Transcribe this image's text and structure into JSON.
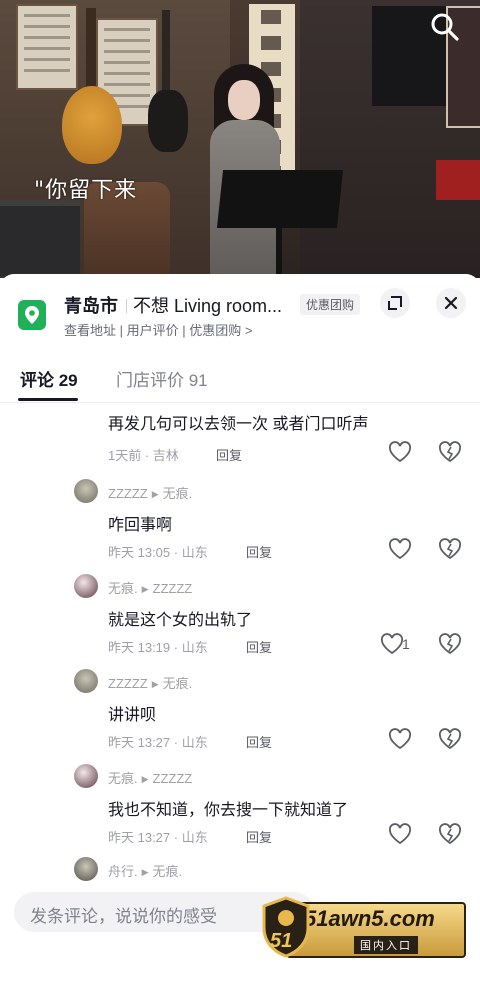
{
  "video": {
    "caption": "\"你留下来"
  },
  "store": {
    "city": "青岛市",
    "venue": "不想 Living room...",
    "deal_badge": "优惠团购",
    "subtitle": "查看地址 | 用户评价 | 优惠团购 >"
  },
  "tabs": [
    {
      "label": "评论 29",
      "active": true
    },
    {
      "label": "门店评价 91",
      "active": false
    }
  ],
  "comments": [
    {
      "user": "",
      "reply_to": "",
      "text": "再发几句可以去领一次 或者门口听声",
      "time": "1天前 · 吉林",
      "reply_label": "回复",
      "likes": ""
    },
    {
      "user": "ZZZZZ",
      "reply_to": "无痕.",
      "text": "咋回事啊",
      "time": "昨天 13:05 · 山东",
      "reply_label": "回复",
      "likes": ""
    },
    {
      "user": "无痕.",
      "reply_to": "ZZZZZ",
      "text": "就是这个女的出轨了",
      "time": "昨天 13:19 · 山东",
      "reply_label": "回复",
      "likes": "1"
    },
    {
      "user": "ZZZZZ",
      "reply_to": "无痕.",
      "text": "讲讲呗",
      "time": "昨天 13:27 · 山东",
      "reply_label": "回复",
      "likes": ""
    },
    {
      "user": "无痕.",
      "reply_to": "ZZZZZ",
      "text": "我也不知道，你去搜一下就知道了",
      "time": "昨天 13:27 · 山东",
      "reply_label": "回复",
      "likes": ""
    },
    {
      "user": "舟行.",
      "reply_to": "无痕.",
      "text": "",
      "time": "",
      "reply_label": "",
      "likes": ""
    }
  ],
  "input": {
    "placeholder": "发条评论，说说你的感受"
  },
  "watermark": {
    "domain": "51awn5.com",
    "entry": "国内入口",
    "badge": "51"
  },
  "colors": {
    "pin_green": "#21b05a",
    "text_primary": "#161823",
    "text_secondary": "#9fa1a8"
  }
}
